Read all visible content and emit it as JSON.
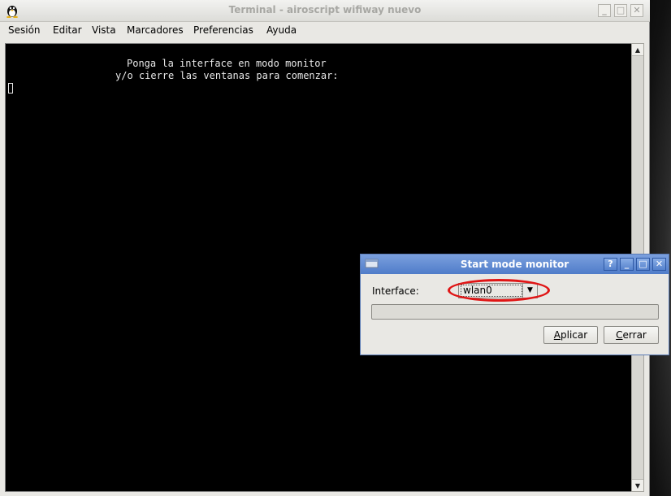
{
  "terminal_window": {
    "title": "Terminal - airoscript wifiway nuevo",
    "controls": {
      "minimize": "_",
      "maximize": "□",
      "close": "✕"
    }
  },
  "menu": {
    "items": [
      {
        "label": "Sesión"
      },
      {
        "label": "Editar"
      },
      {
        "label": "Vista"
      },
      {
        "label": "Marcadores"
      },
      {
        "label": "Preferencias"
      },
      {
        "label": "Ayuda"
      }
    ]
  },
  "terminal": {
    "lines": [
      "Ponga la interface en modo monitor",
      "y/o cierre las ventanas para comenzar:"
    ]
  },
  "dialog": {
    "title": "Start mode monitor",
    "controls": {
      "help": "?",
      "minimize": "_",
      "maximize": "□",
      "close": "✕"
    },
    "interface_label": "Interface:",
    "interface_value": "wlan0",
    "progress": 0,
    "apply_label_first": "A",
    "apply_label_rest": "plicar",
    "close_label_first": "C",
    "close_label_rest": "errar"
  },
  "colors": {
    "highlight_ellipse": "#e01515",
    "dialog_titlebar": "#5a85cf"
  }
}
